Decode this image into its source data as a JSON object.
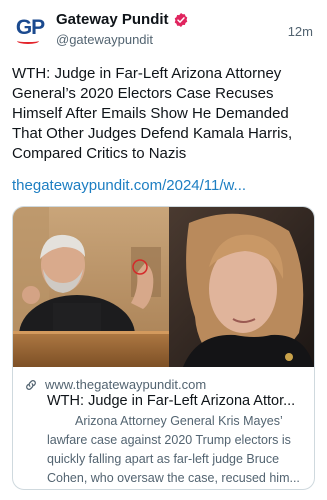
{
  "author": {
    "display_name": "Gateway Pundit",
    "handle": "@gatewaypundit",
    "avatar_text": "GP",
    "verified": true
  },
  "post": {
    "time": "12m",
    "text": "WTH: Judge in Far-Left Arizona Attorney General’s 2020 Electors Case Recuses Himself After Emails Show He Demanded That Other Judges Defend Kamala Harris, Compared Critics to Nazis",
    "link_text": "thegatewaypundit.com/2024/11/w..."
  },
  "card": {
    "domain": "www.thegatewaypundit.com",
    "title": "WTH: Judge in Far-Left Arizona Attor...",
    "description": "Arizona Attorney General Kris Mayes’ lawfare case against 2020 Trump electors is quickly falling apart as far-left judge Bruce Cohen, who oversaw the case, recused him..."
  },
  "icons": {
    "verified": "verified-badge-icon",
    "link": "link-icon"
  },
  "colors": {
    "link": "#1d7ec2",
    "verified_badge": "#e0245e",
    "secondary_text": "#536471",
    "border": "#cfd9de",
    "brand_blue": "#1b4a8f",
    "brand_red": "#e3242b"
  }
}
